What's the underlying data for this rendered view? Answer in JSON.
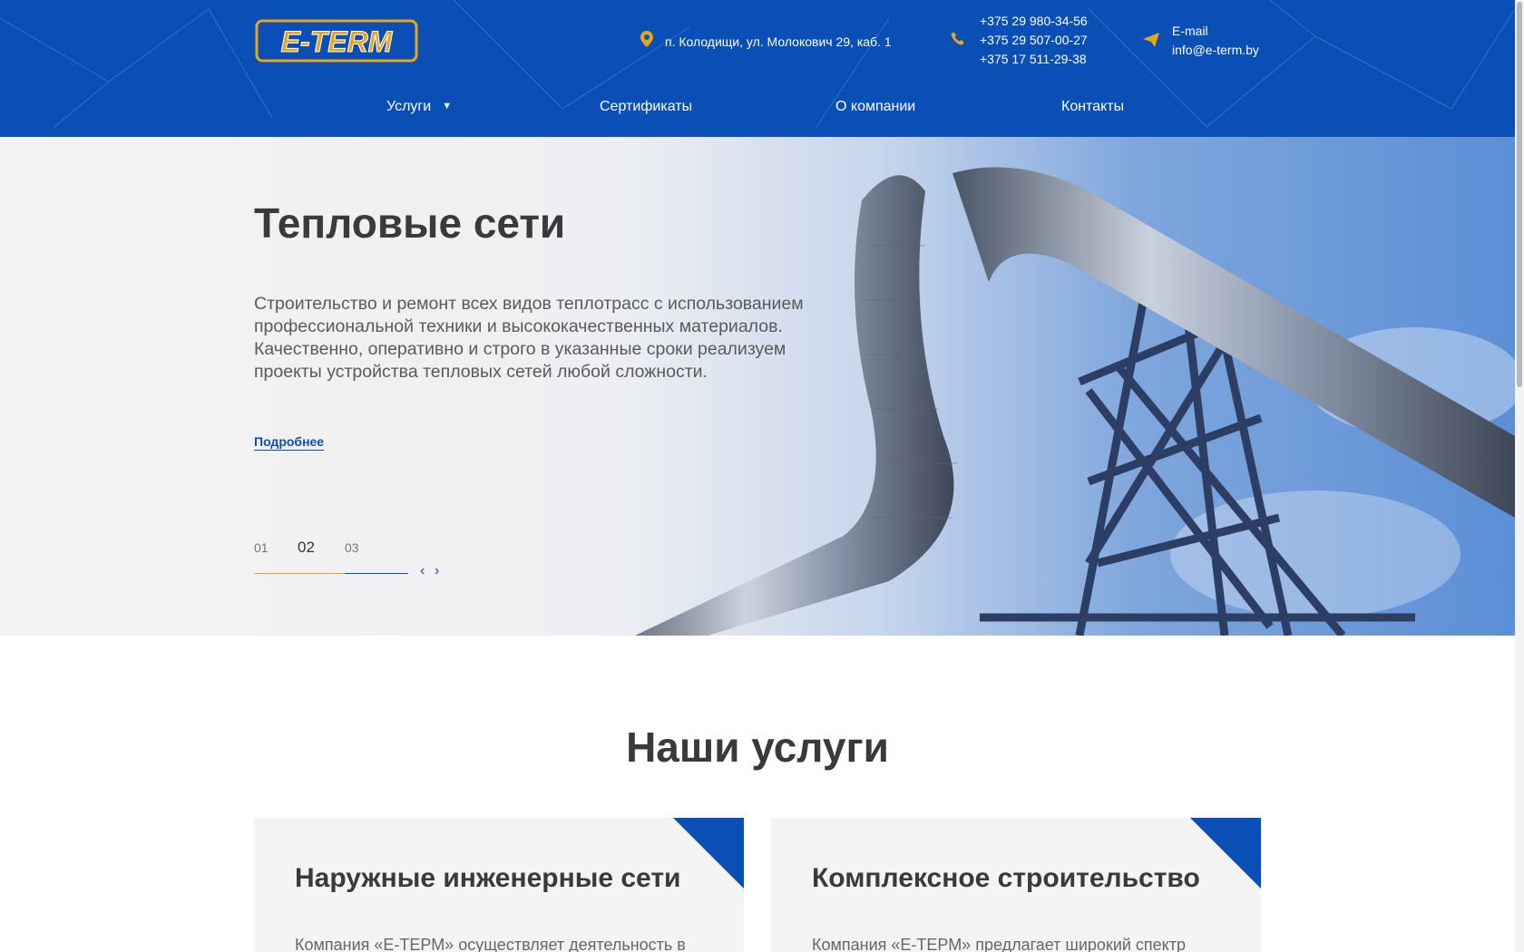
{
  "header": {
    "logo_text": "E-TERM",
    "address": "п. Колодищи, ул. Молокович 29, каб. 1",
    "phones": [
      "+375 29 980-34-56",
      "+375 29 507-00-27",
      "+375 17 511-29-38"
    ],
    "email_label": "E-mail",
    "email": "info@e-term.by",
    "nav": [
      {
        "label": "Услуги"
      },
      {
        "label": "Сертификаты"
      },
      {
        "label": "О компании"
      },
      {
        "label": "Контакты"
      }
    ]
  },
  "hero": {
    "title": "Тепловые сети",
    "text": "Строительство и ремонт всех видов теплотрасс с использованием профессиональной техники и высококачественных материалов. Качественно, оперативно и строго в указанные сроки реализуем проекты устройства тепловых сетей любой сложности.",
    "more_label": "Подробнее",
    "slides": [
      "01",
      "02",
      "03"
    ],
    "active_slide": "02",
    "prev_glyph": "‹",
    "next_glyph": "›"
  },
  "services": {
    "title": "Наши услуги",
    "cards": [
      {
        "title": "Наружные инженерные сети",
        "text": "Компания «Е-ТЕРМ» осуществляет деятельность в"
      },
      {
        "title": "Комплексное строительство",
        "text": "Компания «Е-ТЕРМ» предлагает широкий спектр"
      }
    ]
  },
  "colors": {
    "brand_blue": "#0a4fb5",
    "accent_yellow": "#e8a51c",
    "text_dark": "#3a3a3a"
  },
  "icons": {
    "address": "map-pin-icon",
    "phone": "phone-icon",
    "email": "paper-plane-icon",
    "dropdown": "caret-down-icon"
  }
}
